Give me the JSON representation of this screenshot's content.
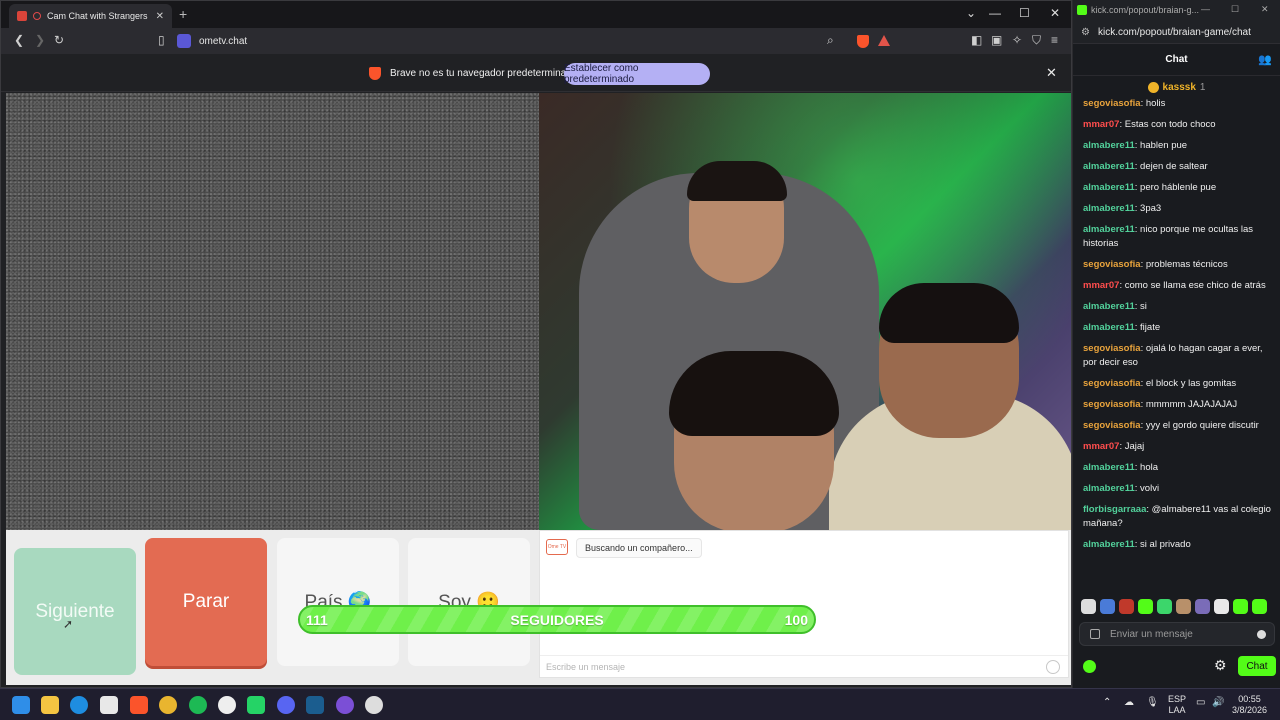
{
  "browser": {
    "tab_title": "Cam Chat with Strangers on (",
    "tab_close": "✕",
    "new_tab": "+",
    "url": "ometv.chat",
    "infobar": {
      "message": "Brave no es tu navegador predeterminado",
      "button": "Establecer como predeterminado",
      "close": "✕"
    }
  },
  "ometv": {
    "buttons": {
      "siguiente": "Siguiente",
      "parar": "Parar",
      "pais": "País 🌍",
      "soy": "Soy 🙂"
    },
    "chat": {
      "logo_text": "Ome TV",
      "status": "Buscando un compañero...",
      "placeholder": "Escribe un mensaje"
    }
  },
  "follower_bar": {
    "current": "111",
    "label": "SEGUIDORES",
    "goal": "100"
  },
  "kick": {
    "window_title": "kick.com/popout/braian-g...",
    "url": "kick.com/popout/braian-game/chat",
    "header": "Chat",
    "pinned": {
      "user": "kasssk",
      "count": "1"
    },
    "messages": [
      {
        "user": "segoviasofia",
        "color": "#e8a33c",
        "text": "holis"
      },
      {
        "user": "mmar07",
        "color": "#ff4d4d",
        "text": "Estas con todo choco"
      },
      {
        "user": "almabere11",
        "color": "#52d19b",
        "text": "hablen pue"
      },
      {
        "user": "almabere11",
        "color": "#52d19b",
        "text": "dejen de saltear"
      },
      {
        "user": "almabere11",
        "color": "#52d19b",
        "text": "pero háblenle pue"
      },
      {
        "user": "almabere11",
        "color": "#52d19b",
        "text": "3pa3"
      },
      {
        "user": "almabere11",
        "color": "#52d19b",
        "text": "nico porque me ocultas las historias"
      },
      {
        "user": "segoviasofia",
        "color": "#e8a33c",
        "text": "problemas técnicos"
      },
      {
        "user": "mmar07",
        "color": "#ff4d4d",
        "text": "como se llama ese chico de atrás"
      },
      {
        "user": "almabere11",
        "color": "#52d19b",
        "text": "si"
      },
      {
        "user": "almabere11",
        "color": "#52d19b",
        "text": "fijate"
      },
      {
        "user": "segoviasofia",
        "color": "#e8a33c",
        "text": "ojalá lo hagan cagar a ever, por decir eso"
      },
      {
        "user": "segoviasofia",
        "color": "#e8a33c",
        "text": "el block y las gomitas"
      },
      {
        "user": "segoviasofia",
        "color": "#e8a33c",
        "text": "mmmmm JAJAJAJAJ"
      },
      {
        "user": "segoviasofia",
        "color": "#e8a33c",
        "text": "yyy el gordo quiere discutir"
      },
      {
        "user": "mmar07",
        "color": "#ff4d4d",
        "text": "Jajaj"
      },
      {
        "user": "almabere11",
        "color": "#52d19b",
        "text": "hola"
      },
      {
        "user": "almabere11",
        "color": "#52d19b",
        "text": "volvi"
      },
      {
        "user": "florbisgarraaa",
        "color": "#52d19b",
        "text": "@almabere11 vas al colegio mañana?"
      },
      {
        "user": "almabere11",
        "color": "#52d19b",
        "text": "si al privado"
      }
    ],
    "input_placeholder": "Enviar un mensaje",
    "chat_button": "Chat"
  },
  "taskbar": {
    "lang_top": "ESP",
    "lang_bottom": "LAA",
    "time": "00:55",
    "date": "3/8/2026"
  }
}
